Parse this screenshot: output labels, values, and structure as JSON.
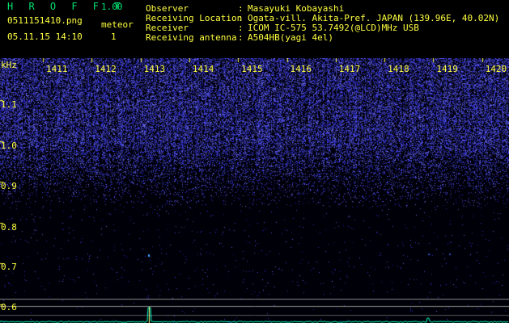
{
  "header": {
    "app_name": "H R O F F T",
    "version": "1.00",
    "filename": "0511151410.png",
    "datetime": "05.11.15 14:10",
    "meteor_label": "meteor",
    "meteor_count": "1"
  },
  "info": [
    {
      "label": "Observer",
      "value": "Masayuki Kobayashi"
    },
    {
      "label": "Receiving Location",
      "value": "Ogata-vill. Akita-Pref. JAPAN (139.96E, 40.02N)"
    },
    {
      "label": "Receiver",
      "value": "ICOM IC-575 53.7492(@LCD)MHz USB"
    },
    {
      "label": "Receiving antenna",
      "value": "A504HB(yagi 4el)"
    }
  ],
  "colon": ":",
  "axis": {
    "unit": "kHz",
    "y_ticks": [
      "1.1",
      "1.0",
      "0.9",
      "0.8",
      "0.7",
      "0.6"
    ],
    "minute_labels": [
      "1411",
      "1412",
      "1413",
      "1414",
      "1415",
      "1416",
      "1417",
      "1418",
      "1419",
      "1420"
    ]
  },
  "colors": {
    "title_green": "#00e070",
    "text_yellow": "#ffff40",
    "noise_blue": "#2838ff",
    "signal_cyan": "#00ffc0"
  }
}
